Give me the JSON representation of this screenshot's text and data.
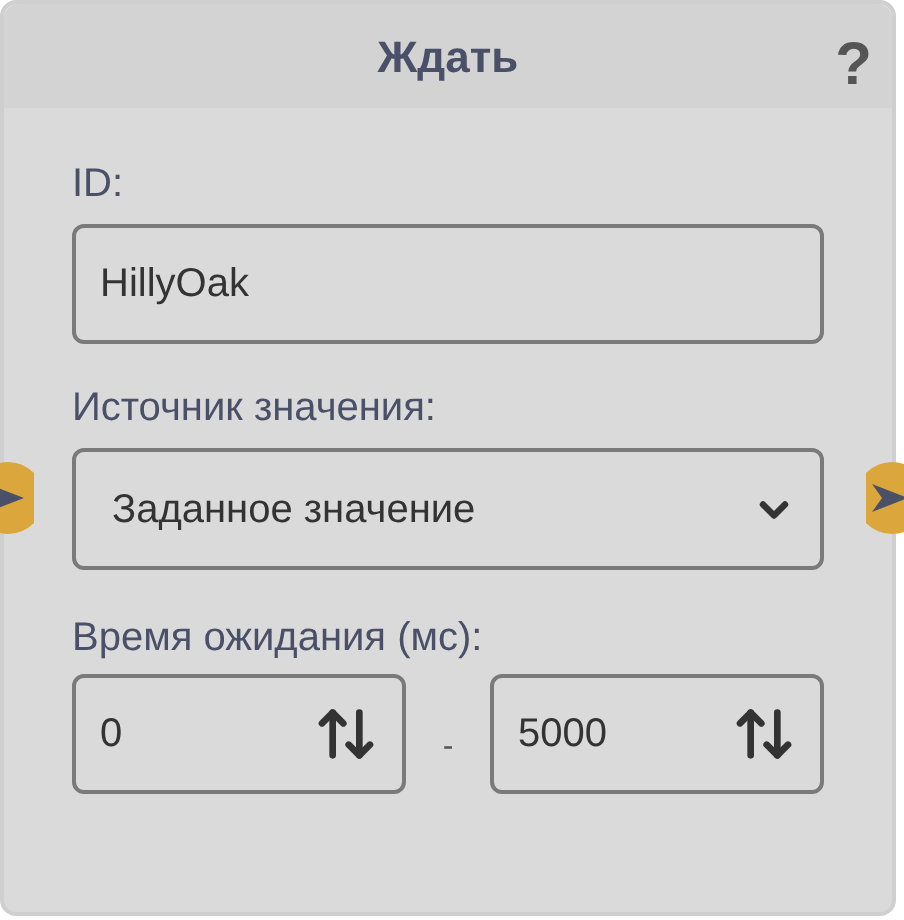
{
  "node": {
    "title": "Ждать",
    "help": "?"
  },
  "id_field": {
    "label": "ID:",
    "value": "HillyOak"
  },
  "source_field": {
    "label": "Источник значения:",
    "value": "Заданное значение"
  },
  "wait_time": {
    "label": "Время ожидания (мс):",
    "min": "0",
    "separator": "-",
    "max": "5000"
  }
}
